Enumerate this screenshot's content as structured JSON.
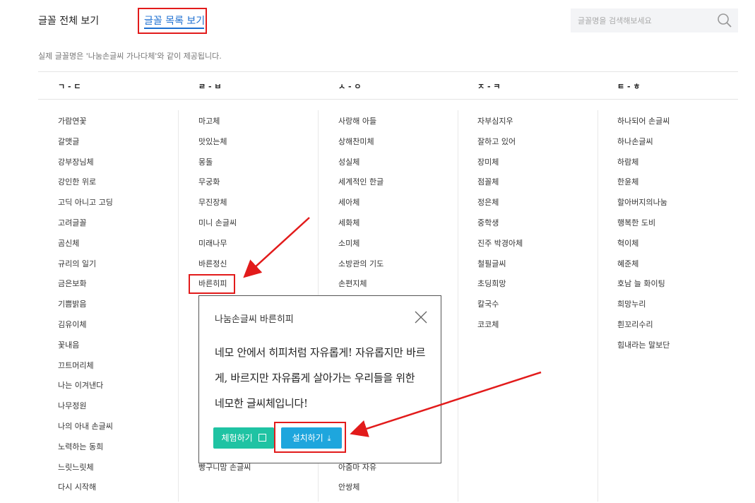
{
  "tabs": {
    "all": "글꼴 전체 보기",
    "list": "글꼴 목록 보기"
  },
  "search": {
    "placeholder": "글꼴명을 검색해보세요"
  },
  "notice": "실제 글꼴명은 '나눔손글씨 가나다체'와 같이 제공됩니다.",
  "columns": [
    {
      "header": "ㄱ - ㄷ",
      "items": [
        "가람연꽃",
        "갈맷글",
        "강부장님체",
        "강인한 위로",
        "고딕 아니고 고딩",
        "고려글꼴",
        "곰신체",
        "규리의 일기",
        "금은보화",
        "기쁨밝음",
        "김유이체",
        "꽃내음",
        "끄트머리체",
        "나는 이겨낸다",
        "나무정원",
        "나의 아내 손글씨",
        "노력하는 동희",
        "느릿느릿체",
        "다시 시작해"
      ]
    },
    {
      "header": "ㄹ - ㅂ",
      "items": [
        "마고체",
        "맛있는체",
        "몽돌",
        "무궁화",
        "무진장체",
        "미니 손글씨",
        "미래나무",
        "바른정신",
        "바른히피",
        "",
        "",
        "",
        "",
        "",
        "",
        "",
        "",
        "빵구니맘 손글씨"
      ]
    },
    {
      "header": "ㅅ - ㅇ",
      "items": [
        "사랑해 아들",
        "상해찬미체",
        "성실체",
        "세계적인 한글",
        "세아체",
        "세화체",
        "소미체",
        "소방관의 기도",
        "손편지체",
        "",
        "",
        "",
        "",
        "",
        "",
        "",
        "",
        "아줌마 자유",
        "안쌍체"
      ]
    },
    {
      "header": "ㅈ - ㅋ",
      "items": [
        "자부심지우",
        "잘하고 있어",
        "장미체",
        "점꼴체",
        "정은체",
        "중학생",
        "진주 박경아체",
        "철필글씨",
        "초딩희망",
        "칼국수",
        "코코체"
      ]
    },
    {
      "header": "ㅌ - ㅎ",
      "items": [
        "하나되어 손글씨",
        "하나손글씨",
        "하람체",
        "한윤체",
        "할아버지의나눔",
        "행복한 도비",
        "혁이체",
        "혜준체",
        "호남 늘 화이팅",
        "희망누리",
        "흰꼬리수리",
        "힘내라는 말보단"
      ]
    }
  ],
  "popup": {
    "title": "나눔손글씨 바른히피",
    "preview": "네모 안에서 히피처럼 자유롭게! 자유롭지만 바르게, 바르지만 자유롭게 살아가는 우리들을 위한 네모한 글씨체입니다!",
    "try_label": "체험하기",
    "install_label": "설치하기"
  },
  "colors": {
    "accent": "#1d6fd1",
    "highlight": "#e21b1b",
    "try": "#1fc3a3",
    "install": "#1ea6dd"
  }
}
